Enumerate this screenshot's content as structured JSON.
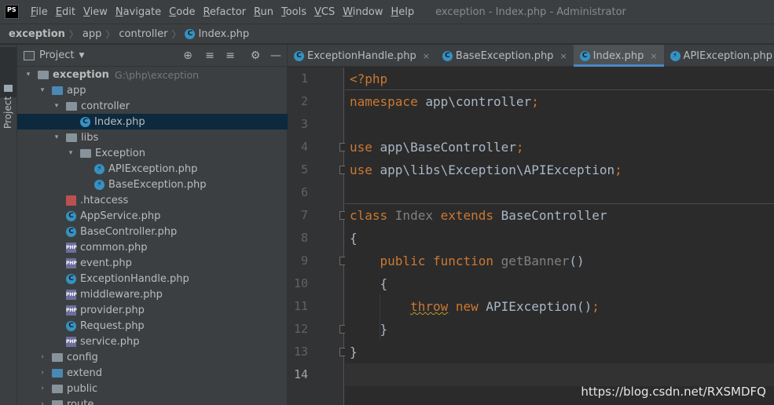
{
  "app": {
    "logo_text": "PS",
    "window_title": "exception - Index.php - Administrator"
  },
  "menu": [
    "File",
    "Edit",
    "View",
    "Navigate",
    "Code",
    "Refactor",
    "Run",
    "Tools",
    "VCS",
    "Window",
    "Help"
  ],
  "breadcrumb": {
    "items": [
      "exception",
      "app",
      "controller",
      "Index.php"
    ],
    "file_icon_letter": "C"
  },
  "stripe": {
    "project_label": "Project"
  },
  "project_panel": {
    "title": "Project",
    "tools": {
      "locate": "⊕",
      "expand": "≡",
      "collapse": "≡",
      "settings": "⚙",
      "hide": "—"
    },
    "tree": [
      {
        "label": "exception",
        "path_hint": "G:\\php\\exception",
        "arrow": "▾",
        "icon": "folder",
        "bold": true
      },
      {
        "label": "app",
        "arrow": "▾",
        "icon": "folder-blue"
      },
      {
        "label": "controller",
        "arrow": "▾",
        "icon": "folder"
      },
      {
        "label": "Index.php",
        "arrow": "",
        "icon": "class",
        "selected": true
      },
      {
        "label": "libs",
        "arrow": "▾",
        "icon": "folder"
      },
      {
        "label": "Exception",
        "arrow": "▾",
        "icon": "folder"
      },
      {
        "label": "APIException.php",
        "arrow": "",
        "icon": "interface"
      },
      {
        "label": "BaseException.php",
        "arrow": "",
        "icon": "interface"
      },
      {
        "label": ".htaccess",
        "arrow": "",
        "icon": "htaccess"
      },
      {
        "label": "AppService.php",
        "arrow": "",
        "icon": "class"
      },
      {
        "label": "BaseController.php",
        "arrow": "",
        "icon": "class"
      },
      {
        "label": "common.php",
        "arrow": "",
        "icon": "php"
      },
      {
        "label": "event.php",
        "arrow": "",
        "icon": "php"
      },
      {
        "label": "ExceptionHandle.php",
        "arrow": "",
        "icon": "class"
      },
      {
        "label": "middleware.php",
        "arrow": "",
        "icon": "php"
      },
      {
        "label": "provider.php",
        "arrow": "",
        "icon": "php"
      },
      {
        "label": "Request.php",
        "arrow": "",
        "icon": "class"
      },
      {
        "label": "service.php",
        "arrow": "",
        "icon": "php"
      },
      {
        "label": "config",
        "arrow": "›",
        "icon": "folder"
      },
      {
        "label": "extend",
        "arrow": "›",
        "icon": "folder-blue"
      },
      {
        "label": "public",
        "arrow": "›",
        "icon": "folder"
      },
      {
        "label": "route",
        "arrow": "›",
        "icon": "folder"
      }
    ]
  },
  "editor_tabs": [
    {
      "label": "ExceptionHandle.php",
      "icon": "C",
      "active": false
    },
    {
      "label": "BaseException.php",
      "icon": "C",
      "active": false
    },
    {
      "label": "Index.php",
      "icon": "C",
      "active": true
    },
    {
      "label": "APIException.php",
      "icon": "I",
      "active": false
    }
  ],
  "tab_close_glyph": "×",
  "editor": {
    "line_numbers": [
      "1",
      "2",
      "3",
      "4",
      "5",
      "6",
      "7",
      "8",
      "9",
      "10",
      "11",
      "12",
      "13",
      "14"
    ],
    "current_line": "14",
    "lines": [
      [
        {
          "t": "<?php",
          "c": "kw"
        }
      ],
      [
        {
          "t": "namespace ",
          "c": "kw"
        },
        {
          "t": "app\\controller",
          "c": "cls"
        },
        {
          "t": ";",
          "c": "kw"
        }
      ],
      [],
      [
        {
          "t": "use ",
          "c": "kw"
        },
        {
          "t": "app\\BaseController",
          "c": "cls"
        },
        {
          "t": ";",
          "c": "kw"
        }
      ],
      [
        {
          "t": "use ",
          "c": "kw"
        },
        {
          "t": "app\\libs\\Exception\\APIException",
          "c": "cls"
        },
        {
          "t": ";",
          "c": "kw"
        }
      ],
      [],
      [
        {
          "t": "class ",
          "c": "kw"
        },
        {
          "t": "Index ",
          "c": "muted"
        },
        {
          "t": "extends ",
          "c": "kw"
        },
        {
          "t": "BaseController",
          "c": "cls"
        }
      ],
      [
        {
          "t": "{",
          "c": "cls"
        }
      ],
      [
        {
          "t": "    public function ",
          "c": "kw"
        },
        {
          "t": "getBanner",
          "c": "muted"
        },
        {
          "t": "()",
          "c": "cls"
        }
      ],
      [
        {
          "t": "    {",
          "c": "cls"
        }
      ],
      [
        {
          "t": "        ",
          "c": "cls"
        },
        {
          "t": "throw",
          "c": "kw squiggle"
        },
        {
          "t": " new ",
          "c": "kw"
        },
        {
          "t": "APIException",
          "c": "cls"
        },
        {
          "t": "()",
          "c": "cls"
        },
        {
          "t": ";",
          "c": "kw"
        }
      ],
      [
        {
          "t": "    }",
          "c": "cls"
        }
      ],
      [
        {
          "t": "}",
          "c": "cls"
        }
      ],
      []
    ]
  },
  "watermark": "https://blog.csdn.net/RXSMDFQ"
}
